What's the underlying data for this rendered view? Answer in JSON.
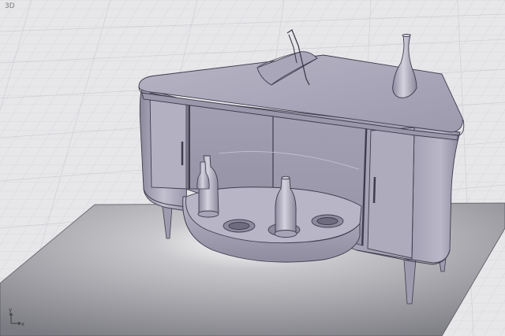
{
  "viewport": {
    "label": "3D",
    "mode": "shaded-perspective"
  },
  "axis_gizmo": {
    "x_label": "x",
    "y_label": "y"
  },
  "colors": {
    "background": "#e7e7ea",
    "grid_line": "#d6d6da",
    "grid_major": "#cdcdd2",
    "ground_plane": "#808087",
    "model_fill": "#a9a6b9",
    "model_light": "#c5c3d1",
    "model_dark": "#8d8a9e",
    "edge": "#3f3c4d"
  },
  "scene_objects": [
    "sideboard-cabinet",
    "glass-doors",
    "bottle-tray",
    "vase",
    "magazine-holder",
    "cabinet-legs"
  ]
}
